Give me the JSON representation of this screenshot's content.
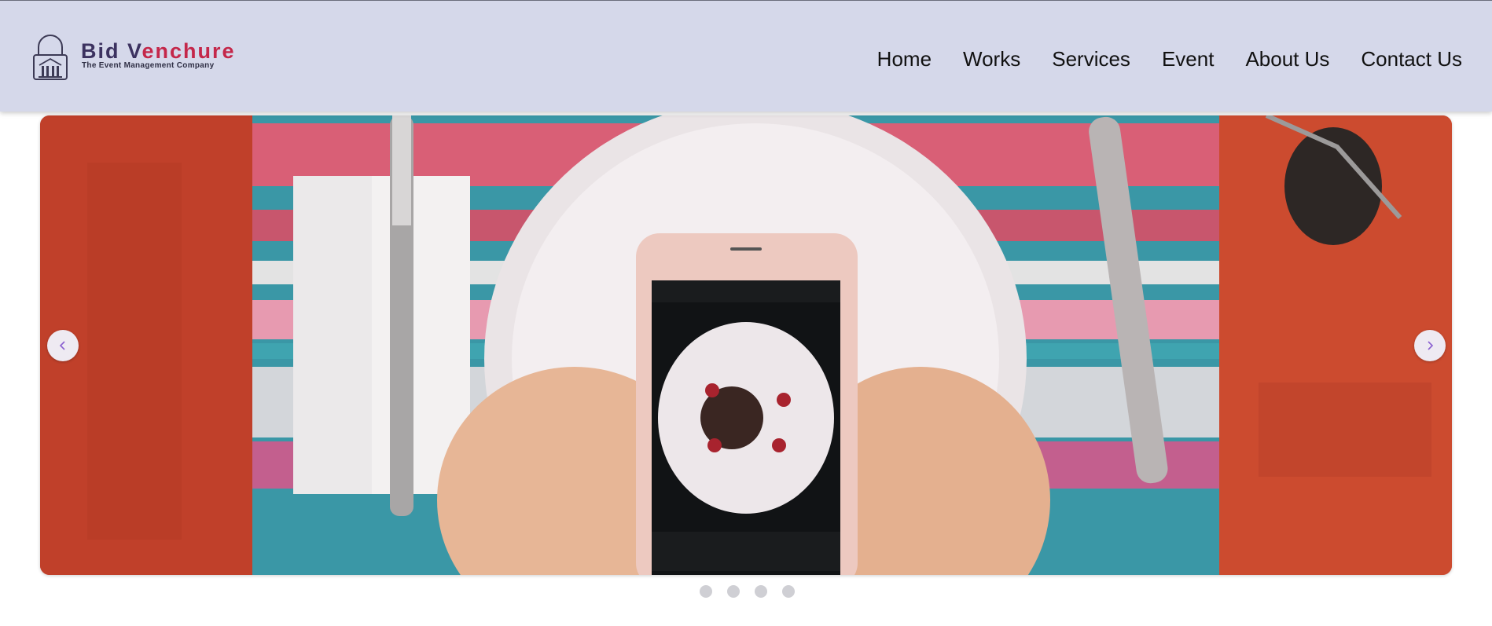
{
  "header": {
    "brand_part1": "Bid V",
    "brand_part2": "enchure",
    "tagline": "The Event Management Company",
    "logo_icon": "padlock-building-icon",
    "background_color": "#d5d8ea"
  },
  "nav": {
    "items": [
      "Home",
      "Works",
      "Services",
      "Event",
      "About Us",
      "Contact Us"
    ]
  },
  "carousel": {
    "slide_description_icon": "photo-slide",
    "prev_icon": "chevron-left-icon",
    "next_icon": "chevron-right-icon",
    "arrow_color": "#8a5fd0",
    "slide_count": 4,
    "active_slide": 1
  },
  "colors": {
    "brand_dark": "#3c3260",
    "brand_accent": "#c4274a"
  }
}
